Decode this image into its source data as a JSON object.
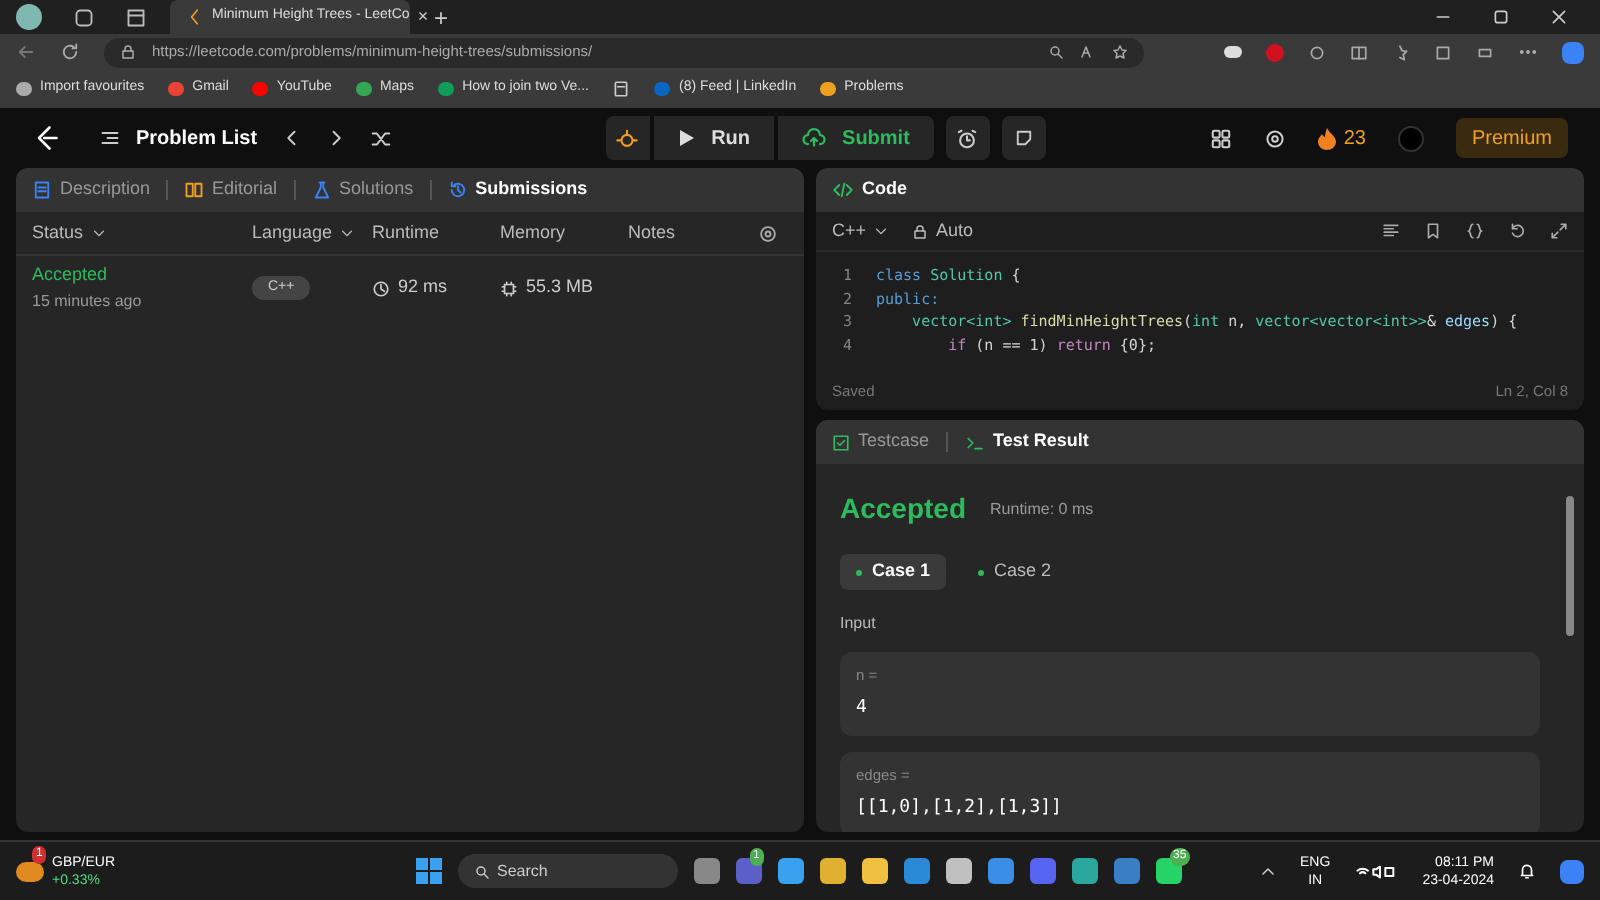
{
  "browser": {
    "tab": {
      "title": "Minimum Height Trees - LeetCo",
      "close": "×"
    },
    "new_tab": "+",
    "url": "https://leetcode.com/problems/minimum-height-trees/submissions/",
    "bookmarks": [
      {
        "label": "Import favourites",
        "kind": "import"
      },
      {
        "label": "Gmail",
        "kind": "gmail"
      },
      {
        "label": "YouTube",
        "kind": "youtube"
      },
      {
        "label": "Maps",
        "kind": "maps"
      },
      {
        "label": "How to join two Ve...",
        "kind": "sheet"
      },
      {
        "label": "(8) Feed | LinkedIn",
        "kind": "linkedin"
      },
      {
        "label": "Problems",
        "kind": "leetcode"
      }
    ]
  },
  "header": {
    "problem_list": "Problem List",
    "run": "Run",
    "submit": "Submit",
    "streak": "23",
    "premium": "Premium"
  },
  "left_panel": {
    "tabs": [
      {
        "label": "Description",
        "selected": false,
        "kind": "description"
      },
      {
        "label": "Editorial",
        "selected": false,
        "kind": "editorial"
      },
      {
        "label": "Solutions",
        "selected": false,
        "kind": "solutions"
      },
      {
        "label": "Submissions",
        "selected": true,
        "kind": "submissions"
      }
    ],
    "columns": [
      {
        "label": "Status",
        "sortable": true
      },
      {
        "label": "Language",
        "sortable": true
      },
      {
        "label": "Runtime",
        "sortable": false
      },
      {
        "label": "Memory",
        "sortable": false
      },
      {
        "label": "Notes",
        "sortable": false
      }
    ],
    "rows": [
      {
        "status": "Accepted",
        "time": "15 minutes ago",
        "language": "C++",
        "runtime": "92 ms",
        "memory": "55.3 MB"
      }
    ]
  },
  "code_panel": {
    "title": "Code",
    "language": "C++",
    "mode": "Auto",
    "lines": [
      {
        "number": "1",
        "tokens": [
          {
            "text": "class ",
            "kind": "keyword"
          },
          {
            "text": "Solution",
            "kind": "type"
          },
          {
            "text": " {",
            "kind": "plain"
          }
        ]
      },
      {
        "number": "2",
        "tokens": [
          {
            "text": "public:",
            "kind": "keyword"
          }
        ]
      },
      {
        "number": "3",
        "tokens": [
          {
            "text": "    vector<int> ",
            "kind": "type"
          },
          {
            "text": "findMinHeightTrees",
            "kind": "func"
          },
          {
            "text": "(",
            "kind": "plain"
          },
          {
            "text": "int",
            "kind": "type"
          },
          {
            "text": " n, ",
            "kind": "plain"
          },
          {
            "text": "vector<vector<int>>",
            "kind": "type"
          },
          {
            "text": "& ",
            "kind": "plain"
          },
          {
            "text": "edges",
            "kind": "param"
          },
          {
            "text": ") {",
            "kind": "plain"
          }
        ]
      },
      {
        "number": "4",
        "tokens": [
          {
            "text": "        if ",
            "kind": "control"
          },
          {
            "text": "(n == 1) ",
            "kind": "plain"
          },
          {
            "text": "return",
            "kind": "control"
          },
          {
            "text": " {0};",
            "kind": "plain"
          }
        ]
      }
    ],
    "status": "Saved",
    "position": "Ln 2, Col 8"
  },
  "result_panel": {
    "tabs": [
      {
        "label": "Testcase",
        "selected": false,
        "kind": "testcase"
      },
      {
        "label": "Test Result",
        "selected": true,
        "kind": "result"
      }
    ],
    "verdict": "Accepted",
    "runtime": "Runtime: 0 ms",
    "cases": [
      {
        "label": "Case 1",
        "selected": true
      },
      {
        "label": "Case 2",
        "selected": false
      }
    ],
    "input_label": "Input",
    "inputs": [
      {
        "name": "n =",
        "value": "4"
      },
      {
        "name": "edges =",
        "value": "[[1,0],[1,2],[1,3]]"
      }
    ]
  },
  "taskbar": {
    "widget": {
      "title": "GBP/EUR",
      "change": "+0.33%",
      "badge": "1"
    },
    "search": "Search",
    "teams_badge": "1",
    "whatsapp_badge": "35",
    "language": "ENG",
    "region": "IN",
    "time": "08:11 PM",
    "date": "23-04-2024"
  }
}
